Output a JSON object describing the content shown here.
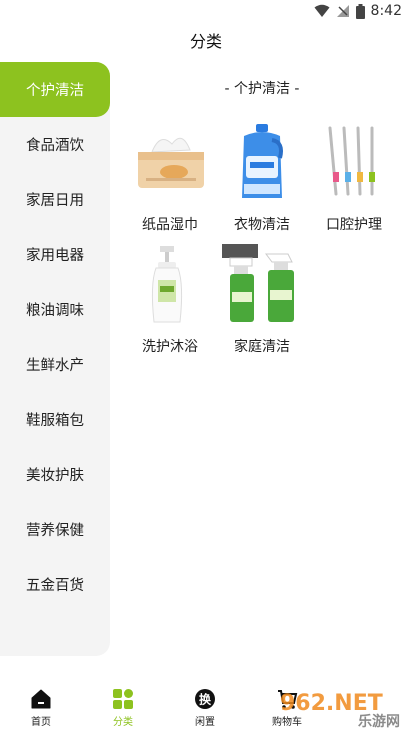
{
  "status": {
    "time": "8:42"
  },
  "header": {
    "title": "分类"
  },
  "sidebar": {
    "items": [
      {
        "label": "个护清洁"
      },
      {
        "label": "食品酒饮"
      },
      {
        "label": "家居日用"
      },
      {
        "label": "家用电器"
      },
      {
        "label": "粮油调味"
      },
      {
        "label": "生鲜水产"
      },
      {
        "label": "鞋服箱包"
      },
      {
        "label": "美妆护肤"
      },
      {
        "label": "营养保健"
      },
      {
        "label": "五金百货"
      }
    ]
  },
  "content": {
    "section_title": "- 个护清洁 -",
    "items": [
      {
        "label": "纸品湿巾"
      },
      {
        "label": "衣物清洁"
      },
      {
        "label": "口腔护理"
      },
      {
        "label": "洗护沐浴"
      },
      {
        "label": "家庭清洁"
      }
    ]
  },
  "bottom_nav": {
    "items": [
      {
        "label": "首页"
      },
      {
        "label": "分类"
      },
      {
        "label": "闲置"
      },
      {
        "label": "购物车"
      }
    ]
  },
  "watermark": {
    "text": "962.NET",
    "sub": "乐游网"
  },
  "colors": {
    "accent": "#8dc21f"
  }
}
